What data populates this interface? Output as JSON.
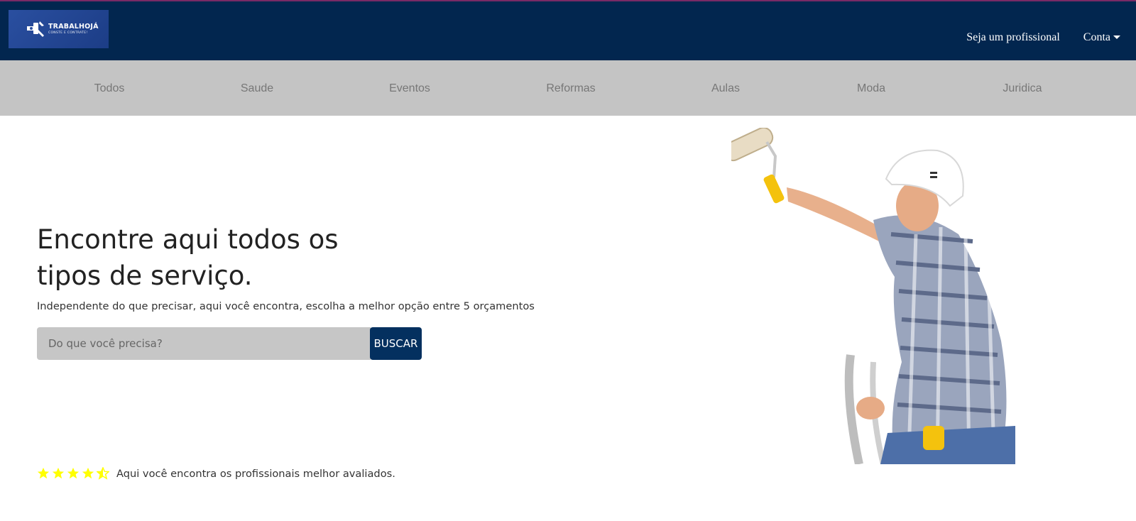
{
  "brand": {
    "name": "TRABALHOJÁ",
    "tagline": "CONSTE E CONTRATE!"
  },
  "topnav": {
    "professional_label": "Seja um profissional",
    "account_label": "Conta"
  },
  "categories": [
    {
      "label": "Todos"
    },
    {
      "label": "Saude"
    },
    {
      "label": "Eventos"
    },
    {
      "label": "Reformas"
    },
    {
      "label": "Aulas"
    },
    {
      "label": "Moda"
    },
    {
      "label": "Juridica"
    }
  ],
  "hero": {
    "title_line1": "Encontre aqui todos os",
    "title_line2": "tipos de serviço.",
    "subtitle": "Independente do que precisar, aqui você encontra, escolha a melhor opção entre 5 orçamentos"
  },
  "search": {
    "placeholder": "Do que você precisa?",
    "value": "",
    "button_label": "BUSCAR"
  },
  "rating": {
    "stars": 4.5,
    "max_stars": 5,
    "text": "Aqui você encontra os profissionais melhor avaliados."
  },
  "colors": {
    "header": "#02264f",
    "category_bar": "#c4c4c4",
    "button": "#04305f",
    "star": "#ffff00"
  },
  "icons": {
    "logo_mark": "tools-icon",
    "account_caret": "caret-down-icon",
    "rating": "star-icon"
  }
}
